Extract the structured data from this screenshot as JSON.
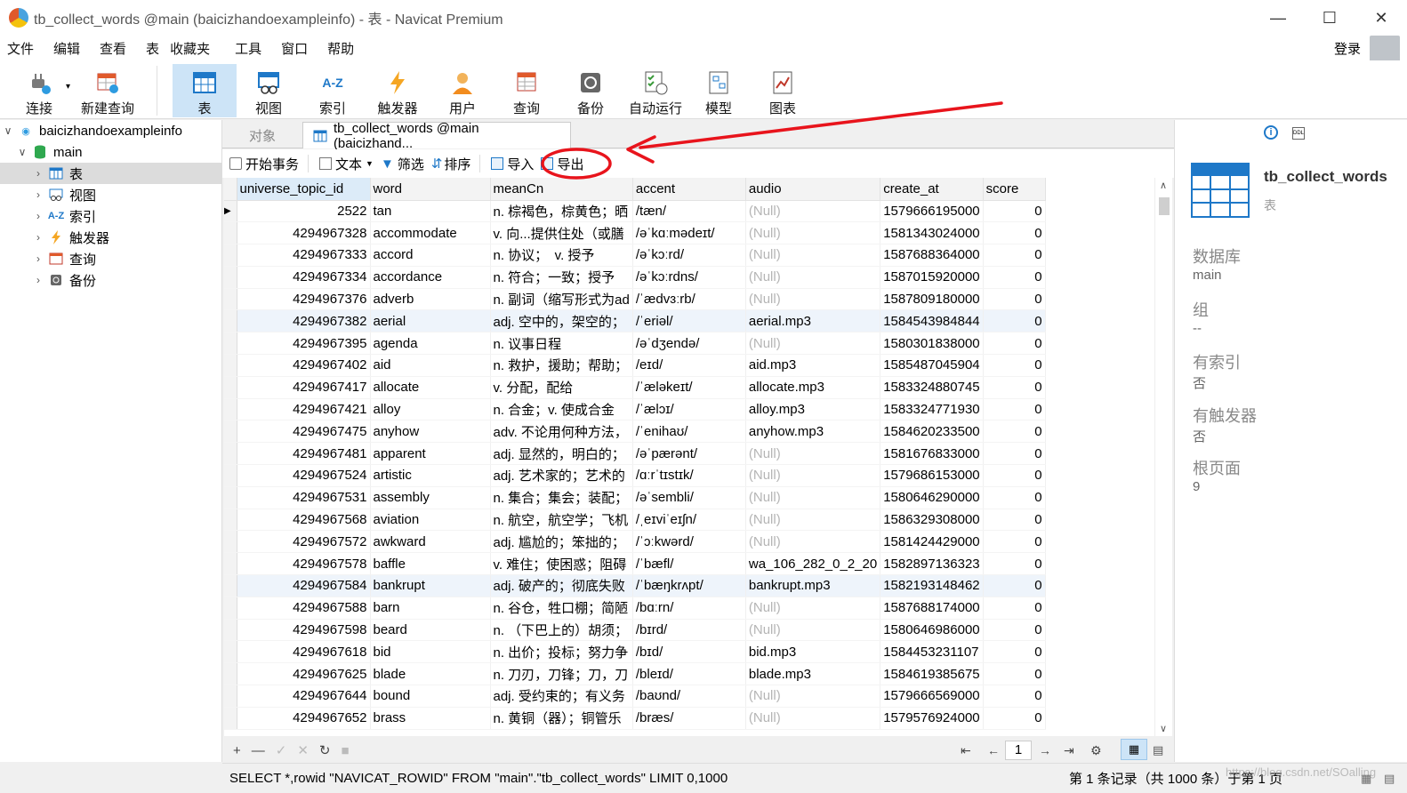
{
  "window": {
    "title": "tb_collect_words @main (baicizhandoexampleinfo) - 表 - Navicat Premium"
  },
  "menu": [
    "文件",
    "编辑",
    "查看",
    "表",
    "收藏夹",
    "工具",
    "窗口",
    "帮助"
  ],
  "login": "登录",
  "toolbar": {
    "connect": "连接",
    "new_query": "新建查询",
    "table": "表",
    "view": "视图",
    "index": "索引",
    "trigger": "触发器",
    "user": "用户",
    "query": "查询",
    "backup": "备份",
    "auto_run": "自动运行",
    "model": "模型",
    "chart": "图表",
    "index_icon_text": "A-Z"
  },
  "sidebar": {
    "connection": "baicizhandoexampleinfo",
    "db": "main",
    "items": [
      "表",
      "视图",
      "索引",
      "触发器",
      "查询",
      "备份"
    ]
  },
  "tabs": {
    "objects": "对象",
    "current": "tb_collect_words @main (baicizhand..."
  },
  "subtoolbar": {
    "begin_tx": "开始事务",
    "text": "文本",
    "filter": "筛选",
    "sort": "排序",
    "import": "导入",
    "export": "导出"
  },
  "grid": {
    "columns": [
      "universe_topic_id",
      "word",
      "meanCn",
      "accent",
      "audio",
      "create_at",
      "score"
    ],
    "rows": [
      [
        "2522",
        "tan",
        "n. 棕褐色，棕黄色；晒",
        "/tæn/",
        "(Null)",
        "1579666195000",
        "0"
      ],
      [
        "4294967328",
        "accommodate",
        "v. 向...提供住处（或膳",
        "/əˈkɑːmədeɪt/",
        "(Null)",
        "1581343024000",
        "0"
      ],
      [
        "4294967333",
        "accord",
        "n. 协议；　v. 授予",
        "/əˈkɔːrd/",
        "(Null)",
        "1587688364000",
        "0"
      ],
      [
        "4294967334",
        "accordance",
        "n. 符合；一致；授予",
        "/əˈkɔːrdns/",
        "(Null)",
        "1587015920000",
        "0"
      ],
      [
        "4294967376",
        "adverb",
        "n. 副词（缩写形式为ad",
        "/ˈædvɜːrb/",
        "(Null)",
        "1587809180000",
        "0"
      ],
      [
        "4294967382",
        "aerial",
        "adj. 空中的，架空的；",
        "/ˈeriəl/",
        "aerial.mp3",
        "1584543984844",
        "0"
      ],
      [
        "4294967395",
        "agenda",
        "n. 议事日程",
        "/əˈdʒendə/",
        "(Null)",
        "1580301838000",
        "0"
      ],
      [
        "4294967402",
        "aid",
        "n. 救护，援助；帮助；",
        "/eɪd/",
        "aid.mp3",
        "1585487045904",
        "0"
      ],
      [
        "4294967417",
        "allocate",
        "v. 分配，配给",
        "/ˈæləkeɪt/",
        "allocate.mp3",
        "1583324880745",
        "0"
      ],
      [
        "4294967421",
        "alloy",
        "n. 合金；v. 使成合金",
        "/ˈælɔɪ/",
        "alloy.mp3",
        "1583324771930",
        "0"
      ],
      [
        "4294967475",
        "anyhow",
        "adv. 不论用何种方法，",
        "/ˈenihaʊ/",
        "anyhow.mp3",
        "1584620233500",
        "0"
      ],
      [
        "4294967481",
        "apparent",
        "adj. 显然的，明白的；",
        "/əˈpærənt/",
        "(Null)",
        "1581676833000",
        "0"
      ],
      [
        "4294967524",
        "artistic",
        "adj. 艺术家的；艺术的",
        "/ɑːrˈtɪstɪk/",
        "(Null)",
        "1579686153000",
        "0"
      ],
      [
        "4294967531",
        "assembly",
        "n. 集合；集会；装配；",
        "/əˈsembli/",
        "(Null)",
        "1580646290000",
        "0"
      ],
      [
        "4294967568",
        "aviation",
        "n. 航空，航空学；飞机",
        "/ˌeɪviˈeɪʃn/",
        "(Null)",
        "1586329308000",
        "0"
      ],
      [
        "4294967572",
        "awkward",
        "adj. 尴尬的；笨拙的；",
        "/ˈɔːkwərd/",
        "(Null)",
        "1581424429000",
        "0"
      ],
      [
        "4294967578",
        "baffle",
        "v. 难住；使困惑；阻碍",
        "/ˈbæfl/",
        "wa_106_282_0_2_20",
        "1582897136323",
        "0"
      ],
      [
        "4294967584",
        "bankrupt",
        "adj. 破产的；彻底失败",
        "/ˈbæŋkrʌpt/",
        "bankrupt.mp3",
        "1582193148462",
        "0"
      ],
      [
        "4294967588",
        "barn",
        "n. 谷仓，牲口棚；简陋",
        "/bɑːrn/",
        "(Null)",
        "1587688174000",
        "0"
      ],
      [
        "4294967598",
        "beard",
        "n. （下巴上的）胡须；",
        "/bɪrd/",
        "(Null)",
        "1580646986000",
        "0"
      ],
      [
        "4294967618",
        "bid",
        "n. 出价；投标；努力争",
        "/bɪd/",
        "bid.mp3",
        "1584453231107",
        "0"
      ],
      [
        "4294967625",
        "blade",
        "n. 刀刃，刀锋；刀，刀",
        "/bleɪd/",
        "blade.mp3",
        "1584619385675",
        "0"
      ],
      [
        "4294967644",
        "bound",
        "adj. 受约束的；有义务",
        "/baʊnd/",
        "(Null)",
        "1579666569000",
        "0"
      ],
      [
        "4294967652",
        "brass",
        "n. 黄铜（器）；铜管乐",
        "/bræs/",
        "(Null)",
        "1579576924000",
        "0"
      ]
    ]
  },
  "nav": {
    "page": "1"
  },
  "status": {
    "sql": "SELECT *,rowid \"NAVICAT_ROWID\" FROM \"main\".\"tb_collect_words\" LIMIT 0,1000",
    "record": "第 1 条记录（共 1000 条）于第 1 页",
    "watermark": "https://blog.csdn.net/SOalling"
  },
  "info_panel": {
    "name": "tb_collect_words",
    "type": "表",
    "labels": [
      "数据库",
      "组",
      "有索引",
      "有触发器",
      "根页面"
    ],
    "values": [
      "main",
      "--",
      "否",
      "否",
      "9"
    ],
    "ddl": "DDL"
  },
  "colors": {
    "accent": "#1e78c8",
    "selected_tool": "#cde4f7",
    "annotation": "#e8141c",
    "null_text": "#b5b5b5"
  }
}
